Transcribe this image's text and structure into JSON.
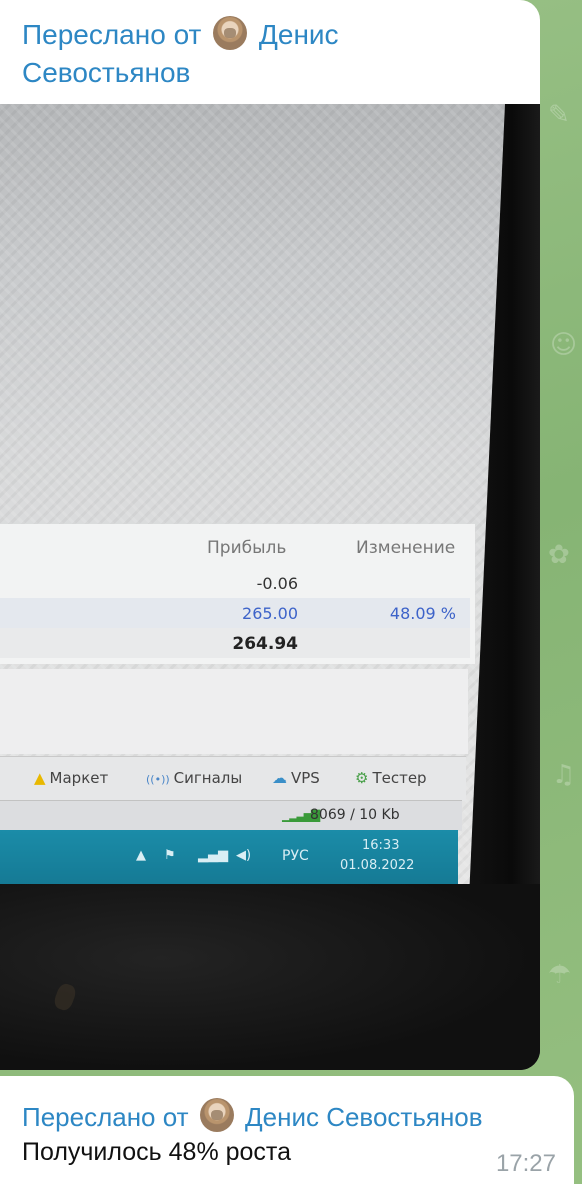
{
  "message1": {
    "forward_prefix": "Переслано от",
    "forward_name": "Денис Севостьянов"
  },
  "photo": {
    "table": {
      "headers": [
        "Прибыль",
        "Изменение"
      ],
      "rows": [
        {
          "profit": "-0.06",
          "change": ""
        },
        {
          "profit": "265.00",
          "change": "48.09 %"
        },
        {
          "profit": "264.94",
          "change": ""
        }
      ]
    },
    "tabs": [
      {
        "icon": "bag-icon",
        "label": "Маркет"
      },
      {
        "icon": "signal-broadcast-icon",
        "label": "Сигналы"
      },
      {
        "icon": "cloud-icon",
        "label": "VPS"
      },
      {
        "icon": "tester-icon",
        "label": "Тестер"
      }
    ],
    "status": {
      "connection": "8069 / 10 Kb"
    },
    "taskbar": {
      "language": "РУС",
      "time": "16:33",
      "date": "01.08.2022"
    }
  },
  "message2": {
    "forward_prefix": "Переслано от",
    "forward_name": "Денис Севостьянов",
    "text": "Получилось 48% роста",
    "time": "17:27"
  },
  "colors": {
    "link": "#2d87c4",
    "background": "#8fb87c",
    "taskbar": "#1b8ca8"
  }
}
